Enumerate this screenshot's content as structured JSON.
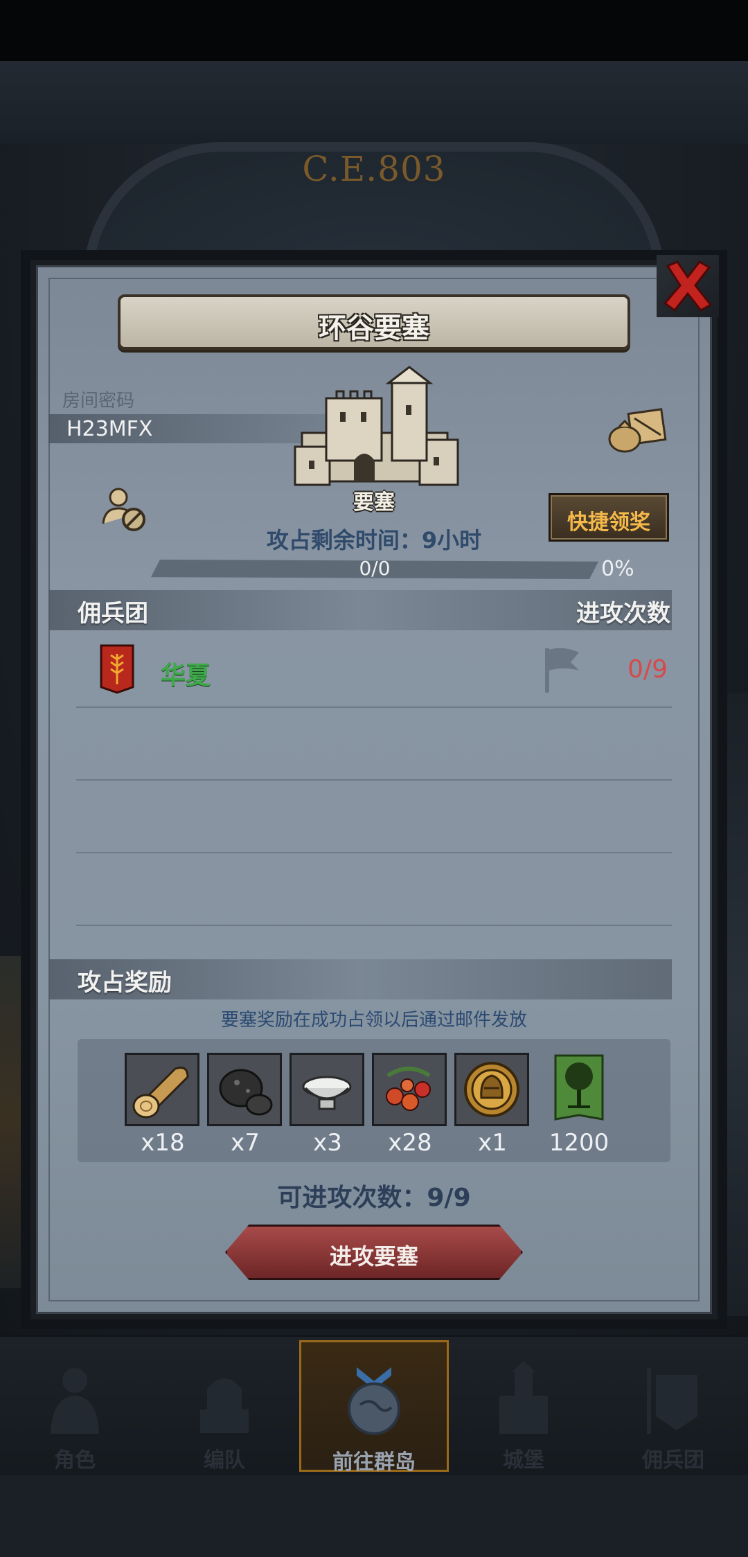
{
  "era": "C.E.803",
  "dialog": {
    "title": "环谷要塞",
    "room_label": "房间密码",
    "room_code": "H23MFX",
    "fort_label": "要塞",
    "quick_claim": "快捷领奖",
    "time_remaining": "攻占剩余时间：9小时",
    "progress": {
      "text": "0/0",
      "percent_text": "0%",
      "fraction": 0
    },
    "guild_section": {
      "left": "佣兵团",
      "right": "进攻次数"
    },
    "guild": {
      "name": "华夏",
      "attacks": "0/9"
    },
    "rewards_section": "攻占奖励",
    "reward_note": "要塞奖励在成功占领以后通过邮件发放",
    "rewards": [
      {
        "icon": "wood-log-icon",
        "qty": "x18"
      },
      {
        "icon": "ore-icon",
        "qty": "x7"
      },
      {
        "icon": "salt-bowl-icon",
        "qty": "x3"
      },
      {
        "icon": "berries-icon",
        "qty": "x28"
      },
      {
        "icon": "helmet-medal-icon",
        "qty": "x1"
      },
      {
        "icon": "tree-banner-icon",
        "qty": "1200"
      }
    ],
    "attempts": "可进攻次数：9/9",
    "attack_button": "进攻要塞"
  },
  "nav": [
    {
      "label": "角色",
      "icon": "knight-icon"
    },
    {
      "label": "编队",
      "icon": "formation-icon"
    },
    {
      "label": "前往群岛",
      "icon": "compass-globe-icon",
      "active": true
    },
    {
      "label": "城堡",
      "icon": "castle-icon"
    },
    {
      "label": "佣兵团",
      "icon": "guild-icon"
    }
  ],
  "colors": {
    "accent_gold": "#f5b94a",
    "guild_green": "#3ea84a",
    "count_red": "#d54a4a"
  }
}
